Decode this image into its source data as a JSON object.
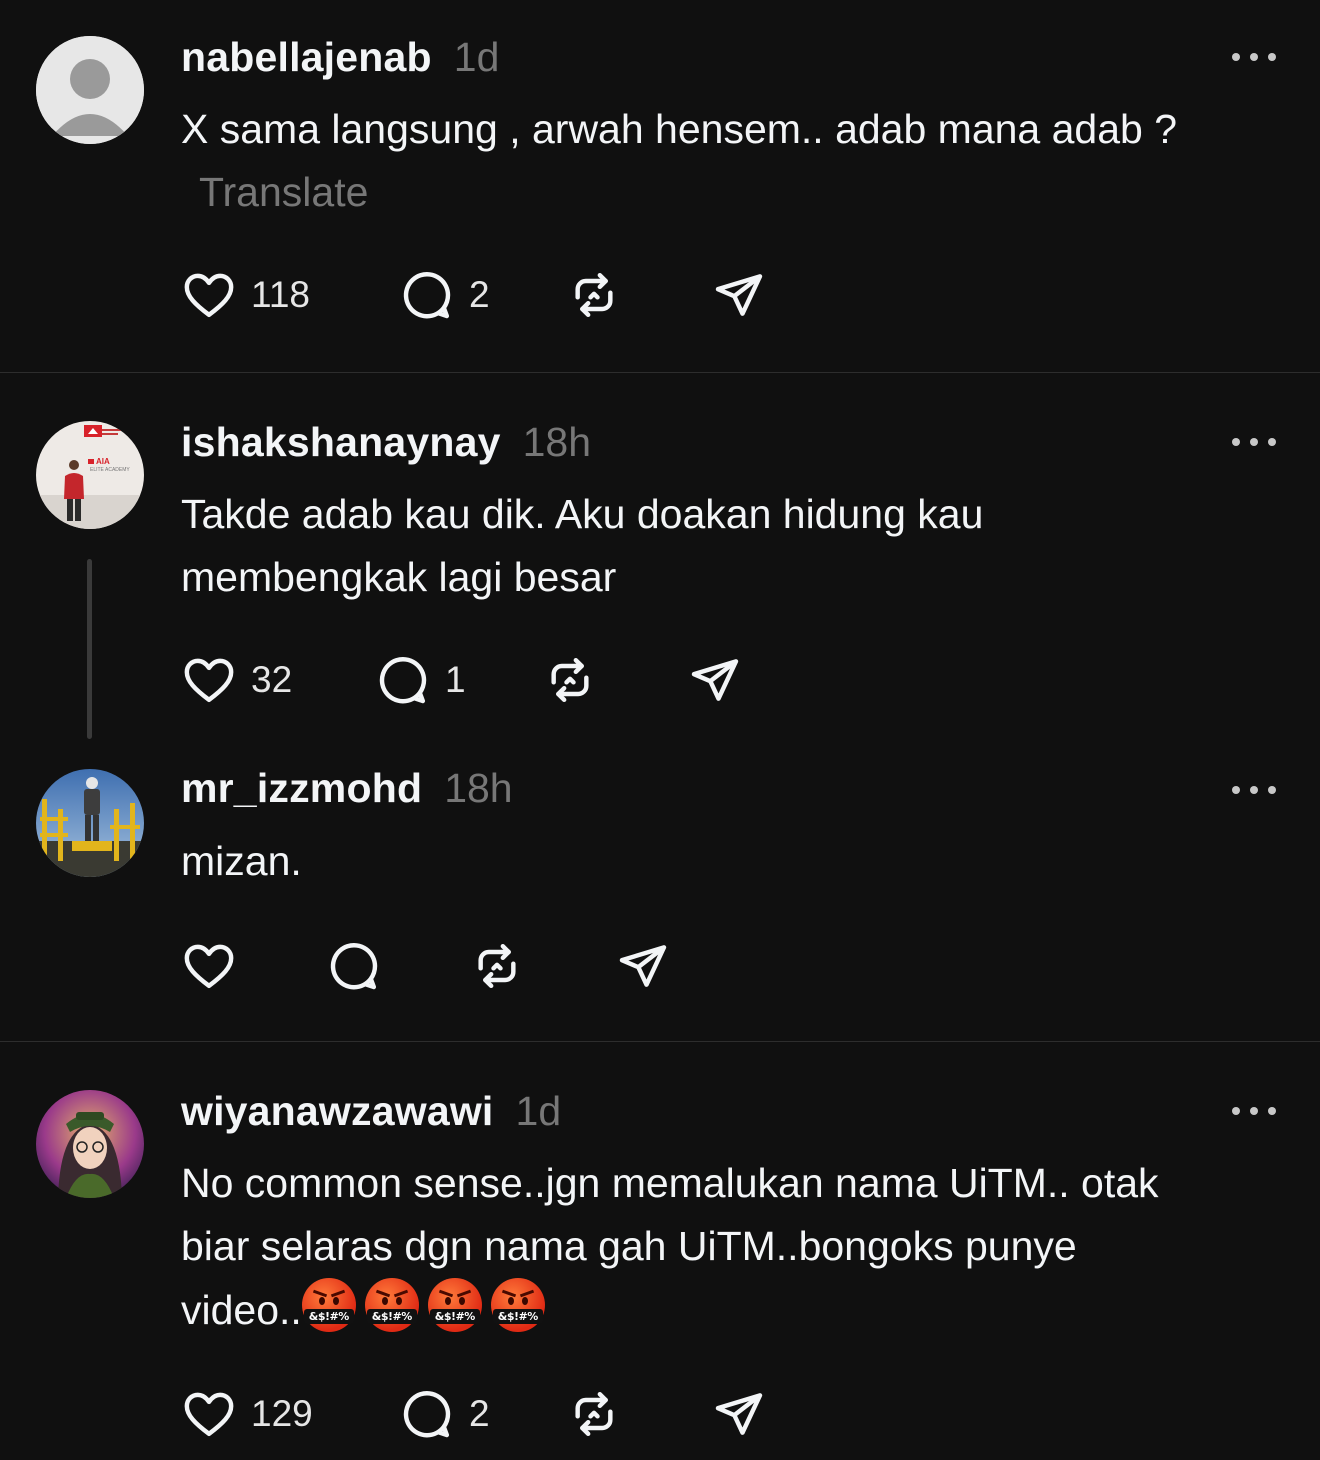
{
  "posts": [
    {
      "username": "nabellajenab",
      "time": "1d",
      "text": "X sama langsung , arwah hensem.. adab mana adab ?",
      "translate": "Translate",
      "likes": "118",
      "replies": "2"
    },
    {
      "username": "ishakshanaynay",
      "time": "18h",
      "text_line1": "Takde adab kau dik. Aku doakan hidung kau",
      "text_line2": "membengkak lagi besar",
      "likes": "32",
      "replies": "1"
    },
    {
      "username": "mr_izzmohd",
      "time": "18h",
      "text": "mizan."
    },
    {
      "username": "wiyanawzawawi",
      "time": "1d",
      "text_line1": "No common sense..jgn memalukan nama UiTM.. otak",
      "text_line2": "biar selaras dgn nama gah UiTM..bongoks punye",
      "text_line3": "video..",
      "emoji_mask_text": "&$!#%",
      "emoji_count": 4,
      "likes": "129",
      "replies": "2"
    }
  ],
  "avatar_texts": {
    "aia": "AIA",
    "aia_sub": "ELITE ACADEMY"
  },
  "colors": {
    "background": "#101010",
    "text": "#f3f5f7",
    "secondary": "#777777",
    "divider": "#2d2d2d"
  },
  "icons": [
    "heart-icon",
    "comment-icon",
    "repost-icon",
    "share-icon",
    "more-icon"
  ]
}
